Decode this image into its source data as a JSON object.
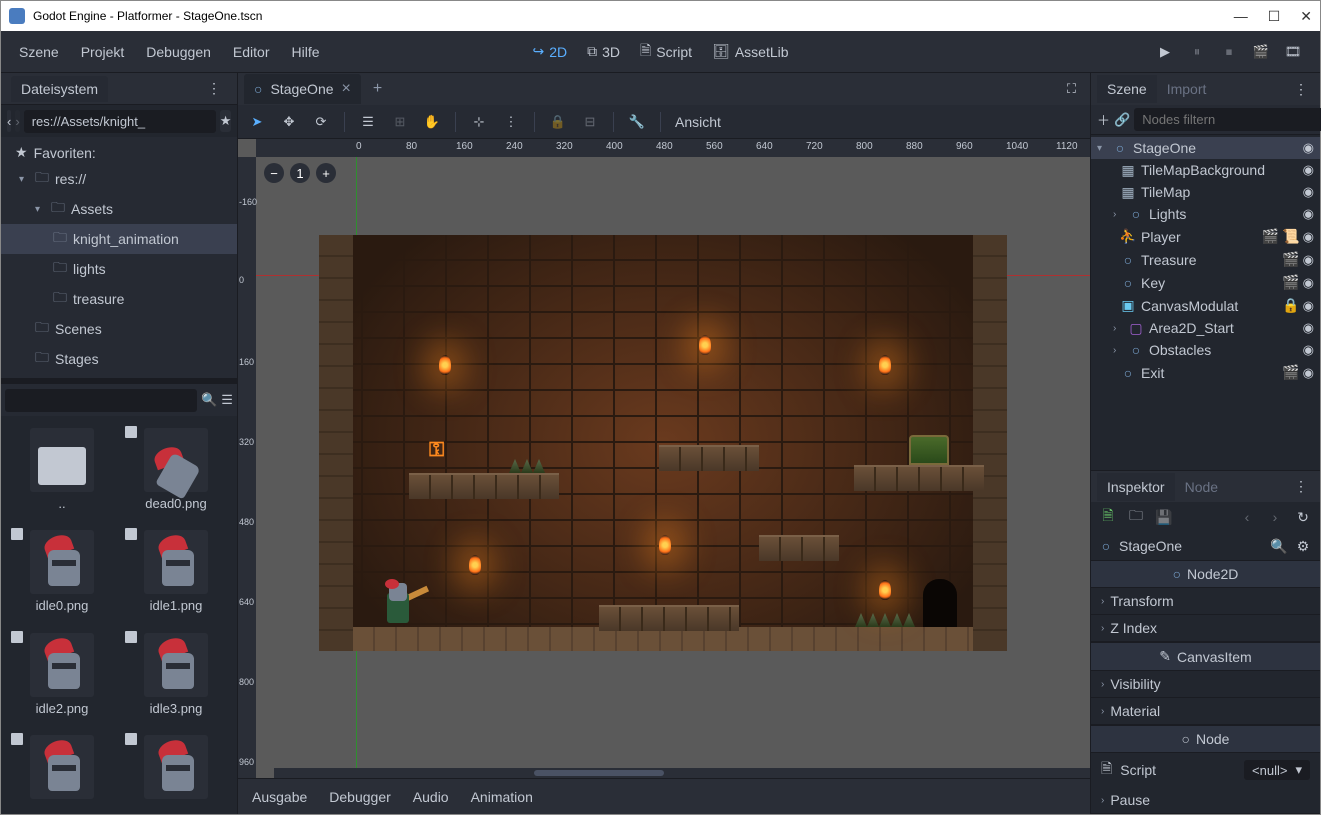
{
  "window": {
    "title": "Godot Engine - Platformer - StageOne.tscn"
  },
  "menubar": {
    "scene": "Szene",
    "project": "Projekt",
    "debug": "Debuggen",
    "editor": "Editor",
    "help": "Hilfe"
  },
  "center_tabs": {
    "mode2d": "2D",
    "mode3d": "3D",
    "script": "Script",
    "assetlib": "AssetLib"
  },
  "filesystem": {
    "title": "Dateisystem",
    "path": "res://Assets/knight_",
    "favorites_label": "Favoriten:",
    "root": "res://",
    "folders": {
      "assets": "Assets",
      "knight_animation": "knight_animation",
      "lights": "lights",
      "treasure": "treasure",
      "scenes": "Scenes",
      "stages": "Stages"
    },
    "files": [
      {
        "name": ".."
      },
      {
        "name": "dead0.png"
      },
      {
        "name": "idle0.png"
      },
      {
        "name": "idle1.png"
      },
      {
        "name": "idle2.png"
      },
      {
        "name": "idle3.png"
      }
    ]
  },
  "scene_tab": {
    "name": "StageOne"
  },
  "viewport": {
    "view_menu": "Ansicht",
    "zoom_minus": "−",
    "zoom_1": "1",
    "zoom_plus": "+",
    "ruler_h": [
      "0",
      "80",
      "160",
      "240",
      "320",
      "400",
      "480",
      "560",
      "640",
      "720",
      "800",
      "880",
      "960",
      "1040",
      "1120"
    ],
    "ruler_v": [
      "-160",
      "0",
      "160",
      "320",
      "480",
      "640",
      "800",
      "960"
    ]
  },
  "bottom_tabs": {
    "output": "Ausgabe",
    "debugger": "Debugger",
    "audio": "Audio",
    "animation": "Animation"
  },
  "scene_dock": {
    "tab_scene": "Szene",
    "tab_import": "Import",
    "filter_placeholder": "Nodes filtern",
    "nodes": {
      "root": "StageOne",
      "tilemap_bg": "TileMapBackground",
      "tilemap": "TileMap",
      "lights": "Lights",
      "player": "Player",
      "treasure": "Treasure",
      "key": "Key",
      "canvasmod": "CanvasModulat",
      "area_start": "Area2D_Start",
      "obstacles": "Obstacles",
      "exit": "Exit"
    }
  },
  "inspector": {
    "tab_inspector": "Inspektor",
    "tab_node": "Node",
    "object": "StageOne",
    "cat_node2d": "Node2D",
    "prop_transform": "Transform",
    "prop_zindex": "Z Index",
    "cat_canvasitem": "CanvasItem",
    "prop_visibility": "Visibility",
    "prop_material": "Material",
    "cat_node": "Node",
    "prop_script": "Script",
    "script_value": "<null>",
    "prop_pause": "Pause"
  }
}
